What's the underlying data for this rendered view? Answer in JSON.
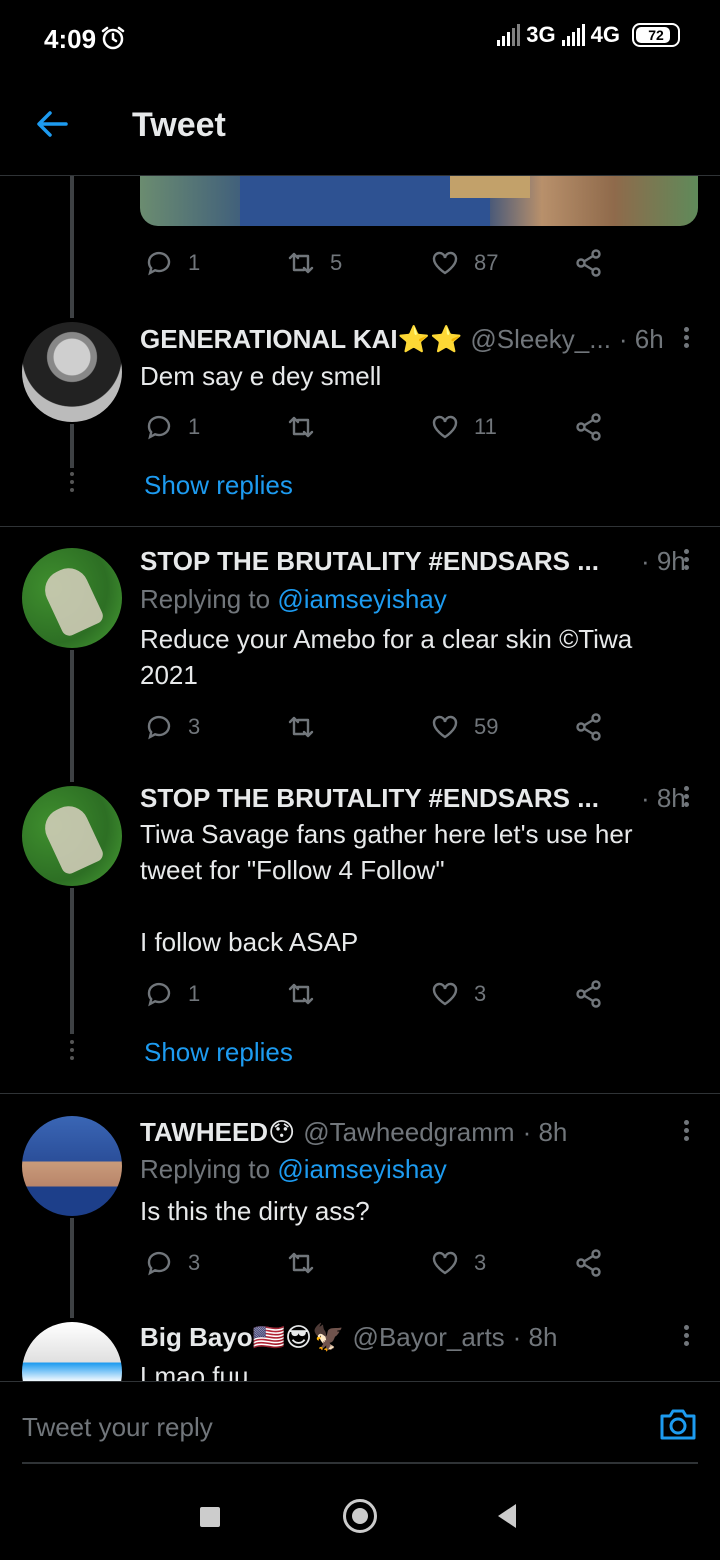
{
  "status_bar": {
    "time": "4:09",
    "net1": "3G",
    "net2": "4G",
    "battery": "72"
  },
  "header": {
    "title": "Tweet"
  },
  "top_tweet": {
    "reply_count": "1",
    "retweet_count": "5",
    "like_count": "87"
  },
  "tweets": [
    {
      "name": "GENERATIONAL KAI⭐⭐",
      "handle": "@Sleeky_...",
      "time": "· 6h",
      "replying_prefix": "",
      "replying_to": "",
      "text": "Dem say e dey smell",
      "reply_count": "1",
      "retweet_count": "",
      "like_count": "11",
      "show_replies": "Show replies"
    },
    {
      "name": "STOP THE BRUTALITY #ENDSARS ...",
      "handle": "",
      "time": "· 9h",
      "replying_prefix": "Replying to ",
      "replying_to": "@iamseyishay",
      "text": "Reduce your Amebo for a clear skin ©Tiwa 2021",
      "reply_count": "3",
      "retweet_count": "",
      "like_count": "59"
    },
    {
      "name": "STOP THE BRUTALITY #ENDSARS ...",
      "handle": "",
      "time": "· 8h",
      "text": "Tiwa Savage fans gather here let's use her tweet for \"Follow 4 Follow\"\n\nI follow back ASAP",
      "reply_count": "1",
      "retweet_count": "",
      "like_count": "3",
      "show_replies": "Show replies"
    },
    {
      "name": "TAWHEED😯",
      "handle": "@Tawheedgramm",
      "time": "· 8h",
      "replying_prefix": "Replying to ",
      "replying_to": "@iamseyishay",
      "text": "Is this the dirty ass?",
      "reply_count": "3",
      "retweet_count": "",
      "like_count": "3"
    },
    {
      "name": "Big Bayo🇺🇸😎🦅",
      "handle": "@Bayor_arts",
      "time": "· 8h",
      "text": "Lmao fuu"
    }
  ],
  "compose": {
    "placeholder": "Tweet your reply"
  }
}
